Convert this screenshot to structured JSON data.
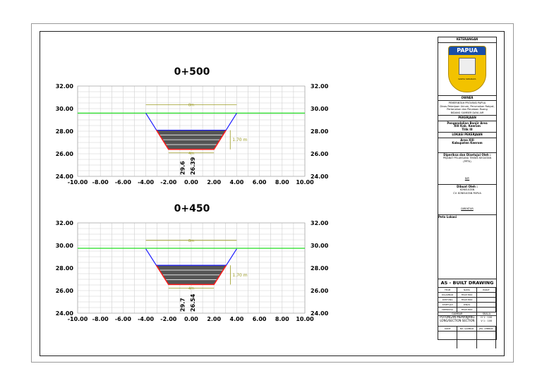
{
  "title_block": {
    "keterangan": "KETERANGAN",
    "logo_text": "PAPUA",
    "logo_motto": "KARYA SWADAYA",
    "owner_label": "OWNER",
    "owner_lines": [
      "PEMERINTAH PROVINSI PAPUA",
      "Dinas Pekerjaan Umum, Perumahan Rakyat, Pertanahan dan Penataan Ruang",
      "BIDANG SUMBER DAYA AIR"
    ],
    "pekerjaan_label": "PEKERJAAN",
    "pekerjaan": [
      "Pengendalian Banjir Area",
      "XIII Kab. Keerom",
      "Tilik III"
    ],
    "lokasi_label": "LOKASI PEKERJAAN",
    "lokasi": [
      "Area XIII",
      "Kabupaten Keerom"
    ],
    "diperiksa_label": "Diperiksa dan Disetujui Oleh :",
    "diperiksa": [
      "PEJABAT PELAKSANA TEKNIS KEGIATAN",
      "(PPTK)"
    ],
    "diperiksa_sign": "NIP.",
    "dibuat_label": "Dibuat Oleh :",
    "dibuat": [
      "KONSULTAN",
      "CV. KONSULTAN PAPUA"
    ],
    "dibuat_sign": "DIREKTUR",
    "peta_label": "Peta Lokasi",
    "as_built": "AS - BUILT DRAWING",
    "team_headers": [
      "TEAM",
      "NAMA",
      "PARAF"
    ],
    "team": [
      [
        "DIGAMBAR",
        "TEAM MKK",
        ""
      ],
      [
        "DIHITUNG",
        "TEAM MKK",
        ""
      ],
      [
        "DISETUJUI",
        "DINAS",
        ""
      ],
      [
        "DIPERIKSA",
        "TEAM MKK",
        ""
      ]
    ],
    "gambar_label": "GAMBAR",
    "skala_label": "SKALA",
    "gambar": "POTONGAN MEMANJANG LONG/SECTION SECTION",
    "skala": [
      "H 1 : 100",
      "V 1 : 100"
    ],
    "bottom_headers": [
      "KODE",
      "NO. GAMBAR",
      "JML. LEMBAR"
    ]
  },
  "sections": [
    {
      "title": "0+500",
      "xlim": [
        -10,
        10
      ],
      "ylim": [
        24,
        32
      ],
      "xticks": [
        "-10.00",
        "-8.00",
        "-6.00",
        "-4.00",
        "-2.00",
        "0.00",
        "2.00",
        "4.00",
        "6.00",
        "8.00",
        "10.00"
      ],
      "yticks": [
        "24.00",
        "26.00",
        "28.00",
        "30.00",
        "32.00"
      ],
      "water_level": 29.6,
      "top_elev": 29.6,
      "bottom_elev": 26.39,
      "sediment_elev": 28.09,
      "top_width": "8m",
      "bottom_width": "4m",
      "depth": "1.70 m",
      "label_top": "29.6",
      "label_bottom": "26.39"
    },
    {
      "title": "0+450",
      "xlim": [
        -10,
        10
      ],
      "ylim": [
        24,
        32
      ],
      "xticks": [
        "-10.00",
        "-8.00",
        "-6.00",
        "-4.00",
        "-2.00",
        "0.00",
        "2.00",
        "4.00",
        "6.00",
        "8.00",
        "10.00"
      ],
      "yticks": [
        "24.00",
        "26.00",
        "28.00",
        "30.00",
        "32.00"
      ],
      "water_level": 29.75,
      "top_elev": 29.7,
      "bottom_elev": 26.54,
      "sediment_elev": 28.24,
      "top_width": "8m",
      "bottom_width": "4m",
      "depth": "1.70 m",
      "label_top": "29.7",
      "label_bottom": "26.54"
    }
  ],
  "colors": {
    "grid": "#cfcfcf",
    "water": "#22dd22",
    "slope_upper": "#1a1aff",
    "slope_lower": "#ff1a1a",
    "sediment": "#555555",
    "dim": "#9a9a20"
  }
}
